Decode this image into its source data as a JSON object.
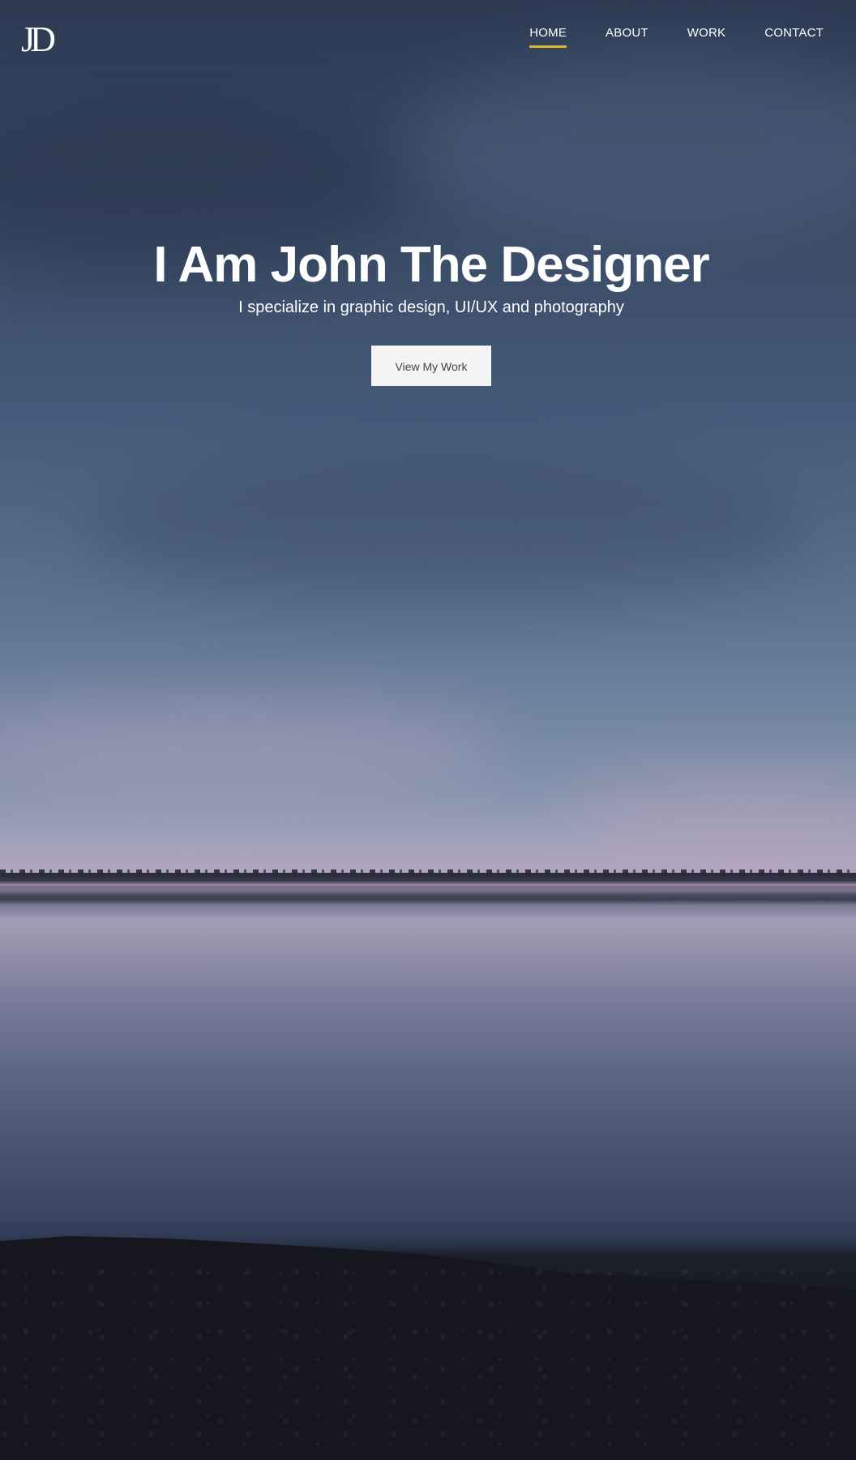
{
  "brand": {
    "logo_text": "JD"
  },
  "nav": {
    "items": [
      {
        "label": "HOME",
        "active": true
      },
      {
        "label": "ABOUT",
        "active": false
      },
      {
        "label": "WORK",
        "active": false
      },
      {
        "label": "CONTACT",
        "active": false
      }
    ]
  },
  "hero": {
    "title": "I Am John The Designer",
    "subtitle": "I specialize in graphic design, UI/UX and photography",
    "button_label": "View My Work"
  },
  "colors": {
    "accent": "#e5b52b",
    "button_bg": "#f4f4f4",
    "button_text": "#444444",
    "text": "#ffffff"
  }
}
